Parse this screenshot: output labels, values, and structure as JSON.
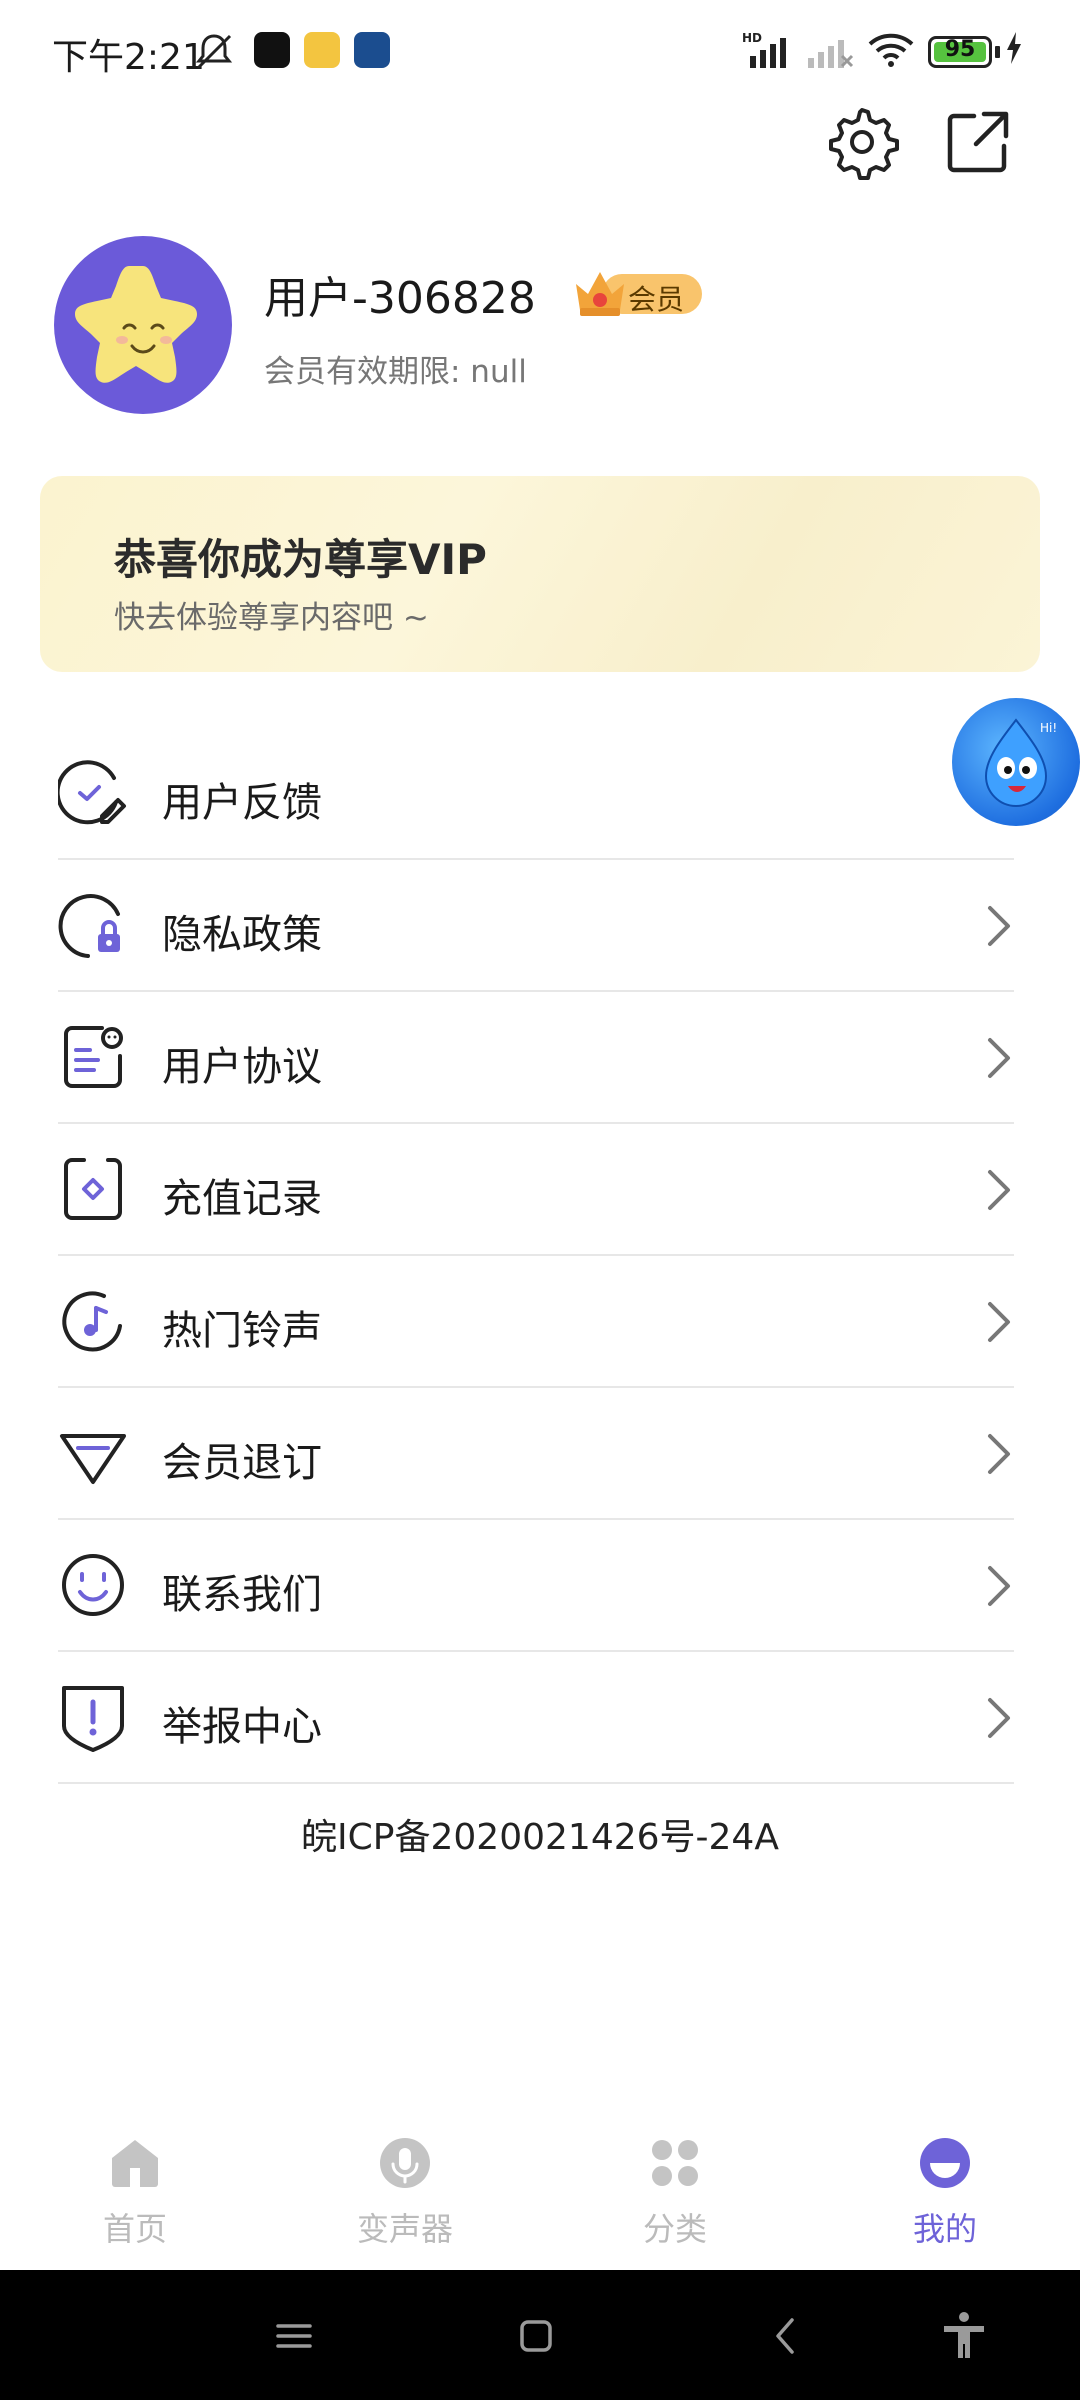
{
  "status_bar": {
    "time": "下午2:21",
    "battery": "95"
  },
  "profile": {
    "username": "用户-306828",
    "vip_badge": "会员",
    "expire": "会员有效期限: null"
  },
  "vip_banner": {
    "title": "恭喜你成为尊享VIP",
    "subtitle": "快去体验尊享内容吧 ~"
  },
  "menu": [
    {
      "label": "用户反馈",
      "icon": "feedback-icon"
    },
    {
      "label": "隐私政策",
      "icon": "privacy-icon"
    },
    {
      "label": "用户协议",
      "icon": "agreement-icon"
    },
    {
      "label": "充值记录",
      "icon": "recharge-icon"
    },
    {
      "label": "热门铃声",
      "icon": "ringtone-icon"
    },
    {
      "label": "会员退订",
      "icon": "unsubscribe-icon"
    },
    {
      "label": "联系我们",
      "icon": "contact-icon"
    },
    {
      "label": "举报中心",
      "icon": "report-icon"
    }
  ],
  "icp": "皖ICP备2020021426号-24A",
  "bottom_nav": [
    {
      "label": "首页",
      "icon": "home-icon",
      "active": false
    },
    {
      "label": "变声器",
      "icon": "mic-icon",
      "active": false
    },
    {
      "label": "分类",
      "icon": "grid-icon",
      "active": false
    },
    {
      "label": "我的",
      "icon": "profile-icon",
      "active": true
    }
  ],
  "colors": {
    "accent": "#6e63d8",
    "avatar_bg": "#6b5ad9",
    "vip_badge": "#f9c46c",
    "inactive_nav": "#bbbbbb"
  }
}
